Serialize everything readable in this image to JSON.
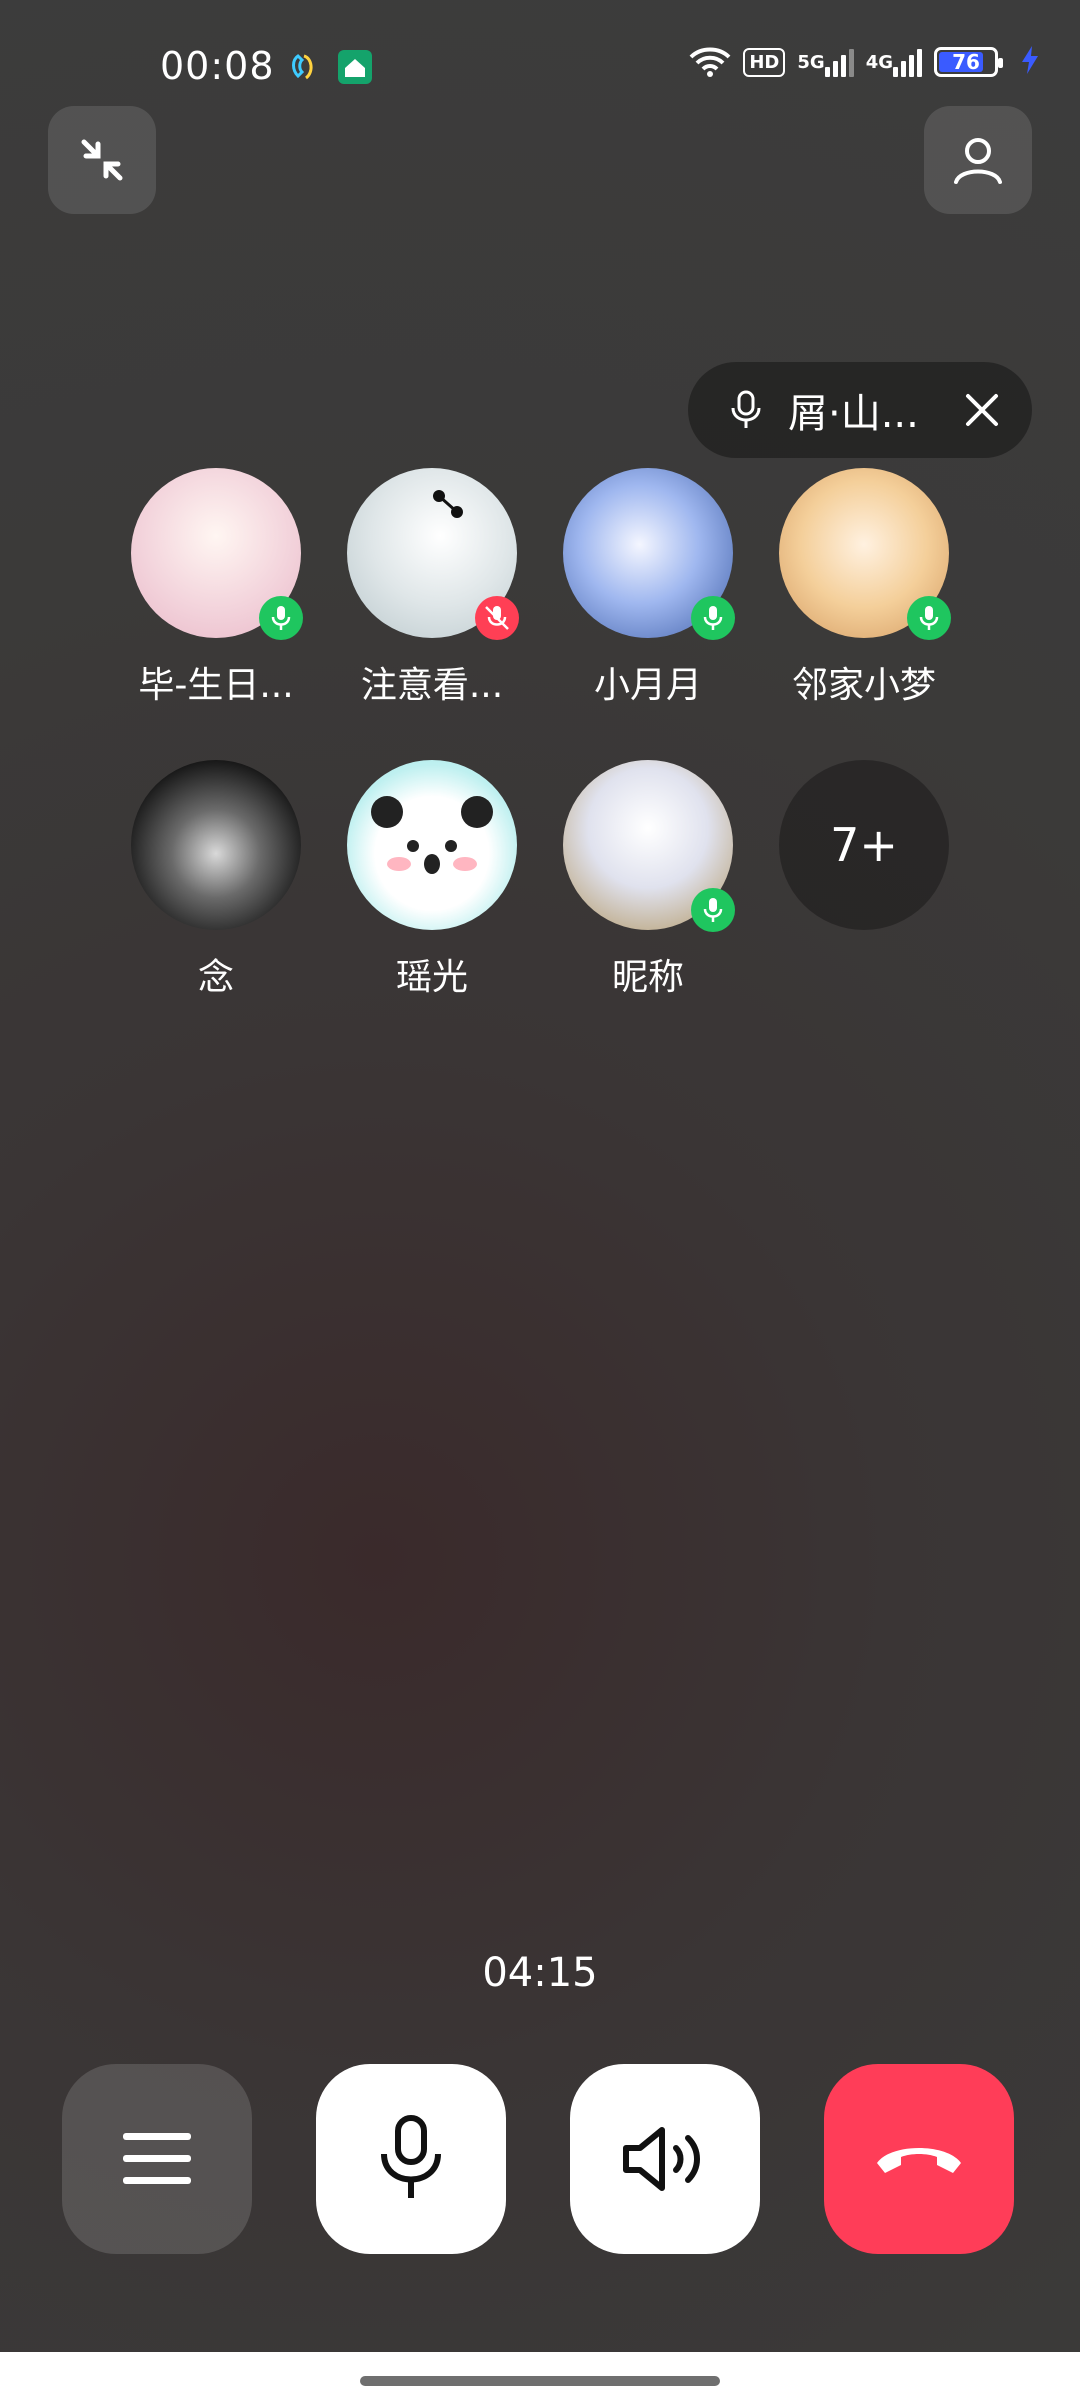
{
  "status_bar": {
    "time": "00:08",
    "hd_label": "HD",
    "net_5g": "5G",
    "net_4g": "4G",
    "battery": "76"
  },
  "speaker_pill": {
    "name": "屑·山..."
  },
  "participants": [
    {
      "name": "毕-生日...",
      "mic": "on",
      "avatar_color": "#f2d7e0"
    },
    {
      "name": "注意看...",
      "mic": "off",
      "avatar_color": "#d9e4e6"
    },
    {
      "name": "小月月",
      "mic": "on",
      "avatar_color": "#cbd7f2"
    },
    {
      "name": "邻家小梦",
      "mic": "on",
      "avatar_color": "#f5d3b3"
    },
    {
      "name": "念",
      "mic": "none",
      "avatar_color": "#2a2a2a"
    },
    {
      "name": "瑶光",
      "mic": "none",
      "avatar_color": "#bfeff0"
    },
    {
      "name": "昵称",
      "mic": "on",
      "avatar_color": "#d9dcec"
    }
  ],
  "more_count": "7+",
  "call_timer": "04:15",
  "icons": {
    "minimize": "minimize-arrows-icon",
    "contacts": "person-icon",
    "pill_mic": "microphone-icon",
    "pill_close": "close-icon",
    "menu": "menu-icon",
    "mic": "microphone-icon",
    "speaker": "speaker-icon",
    "hangup": "hangup-phone-icon"
  },
  "colors": {
    "mic_on": "#1fc65f",
    "mic_off": "#ff3f55",
    "hangup": "#ff3d58"
  }
}
